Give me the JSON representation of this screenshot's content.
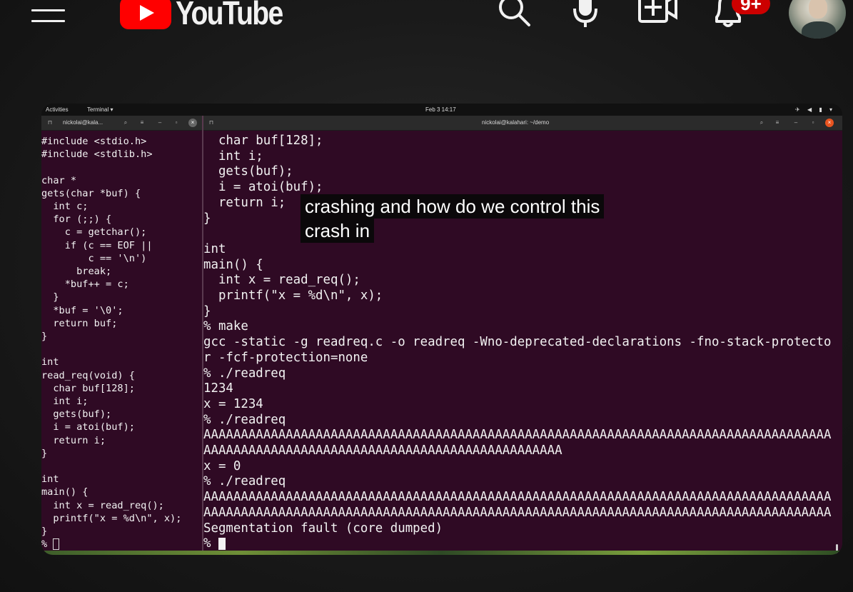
{
  "header": {
    "logo_text": "YouTube",
    "icons": [
      "menu-icon",
      "search-icon",
      "microphone-icon",
      "create-video-icon",
      "bell-icon"
    ],
    "notification_count": "9+",
    "colors": {
      "brand": "#ff0000",
      "badge": "#cc0000",
      "text": "#f1f1f1"
    }
  },
  "desktop": {
    "activities": "Activities",
    "app_menu": "Terminal ▾",
    "clock": "Feb 3  14:17"
  },
  "terminal_left": {
    "title": "nickolai@kala...",
    "lines": [
      "#include <stdio.h>",
      "#include <stdlib.h>",
      "",
      "char *",
      "gets(char *buf) {",
      "  int c;",
      "  for (;;) {",
      "    c = getchar();",
      "    if (c == EOF ||",
      "        c == '\\n')",
      "      break;",
      "    *buf++ = c;",
      "  }",
      "  *buf = '\\0';",
      "  return buf;",
      "}",
      "",
      "int",
      "read_req(void) {",
      "  char buf[128];",
      "  int i;",
      "  gets(buf);",
      "  i = atoi(buf);",
      "  return i;",
      "}",
      "",
      "int",
      "main() {",
      "  int x = read_req();",
      "  printf(\"x = %d\\n\", x);",
      "}",
      "% "
    ]
  },
  "terminal_right": {
    "title": "nickolai@kalahari: ~/demo",
    "lines": [
      "  char buf[128];",
      "  int i;",
      "  gets(buf);",
      "  i = atoi(buf);",
      "  return i;",
      "}",
      "",
      "int",
      "main() {",
      "  int x = read_req();",
      "  printf(\"x = %d\\n\", x);",
      "}",
      "% make",
      "gcc -static -g readreq.c -o readreq -Wno-deprecated-declarations -fno-stack-protecto",
      "r -fcf-protection=none",
      "% ./readreq",
      "1234",
      "x = 1234",
      "% ./readreq",
      "AAAAAAAAAAAAAAAAAAAAAAAAAAAAAAAAAAAAAAAAAAAAAAAAAAAAAAAAAAAAAAAAAAAAAAAAAAAAAAAAAAAA",
      "AAAAAAAAAAAAAAAAAAAAAAAAAAAAAAAAAAAAAAAAAAAAAAAA",
      "x = 0",
      "% ./readreq",
      "AAAAAAAAAAAAAAAAAAAAAAAAAAAAAAAAAAAAAAAAAAAAAAAAAAAAAAAAAAAAAAAAAAAAAAAAAAAAAAAAAAAA",
      "AAAAAAAAAAAAAAAAAAAAAAAAAAAAAAAAAAAAAAAAAAAAAAAAAAAAAAAAAAAAAAAAAAAAAAAAAAAAAAAAAAAA",
      "Segmentation fault (core dumped)",
      "% "
    ]
  },
  "caption": {
    "line1": "crashing and how do we control this",
    "line2": "crash in"
  }
}
